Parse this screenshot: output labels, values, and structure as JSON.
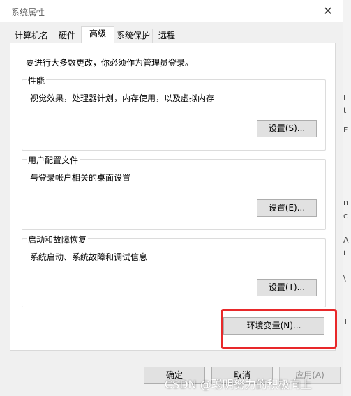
{
  "window": {
    "title": "系统属性",
    "close_glyph": "✕"
  },
  "tabs": [
    {
      "label": "计算机名",
      "active": false
    },
    {
      "label": "硬件",
      "active": false
    },
    {
      "label": "高级",
      "active": true
    },
    {
      "label": "系统保护",
      "active": false
    },
    {
      "label": "远程",
      "active": false
    }
  ],
  "advanced": {
    "admin_note": "要进行大多数更改，你必须作为管理员登录。",
    "performance": {
      "label": "性能",
      "description": "视觉效果，处理器计划，内存使用，以及虚拟内存",
      "button": "设置(S)..."
    },
    "user_profiles": {
      "label": "用户配置文件",
      "description": "与登录帐户相关的桌面设置",
      "button": "设置(E)..."
    },
    "startup_recovery": {
      "label": "启动和故障恢复",
      "description": "系统启动、系统故障和调试信息",
      "button": "设置(T)..."
    },
    "env_vars_button": "环境变量(N)..."
  },
  "footer": {
    "ok": "确定",
    "cancel": "取消",
    "apply": "应用(A)"
  },
  "watermark": "CSDN @聪明努力的积极向上",
  "right_strip_chars": [
    "I",
    "t",
    "F",
    "n",
    "c",
    "A",
    "i",
    "\\",
    "T"
  ],
  "colors": {
    "highlight_box": "#e8282a",
    "dialog_bg": "#f0f0f0",
    "panel_bg": "#ffffff"
  }
}
